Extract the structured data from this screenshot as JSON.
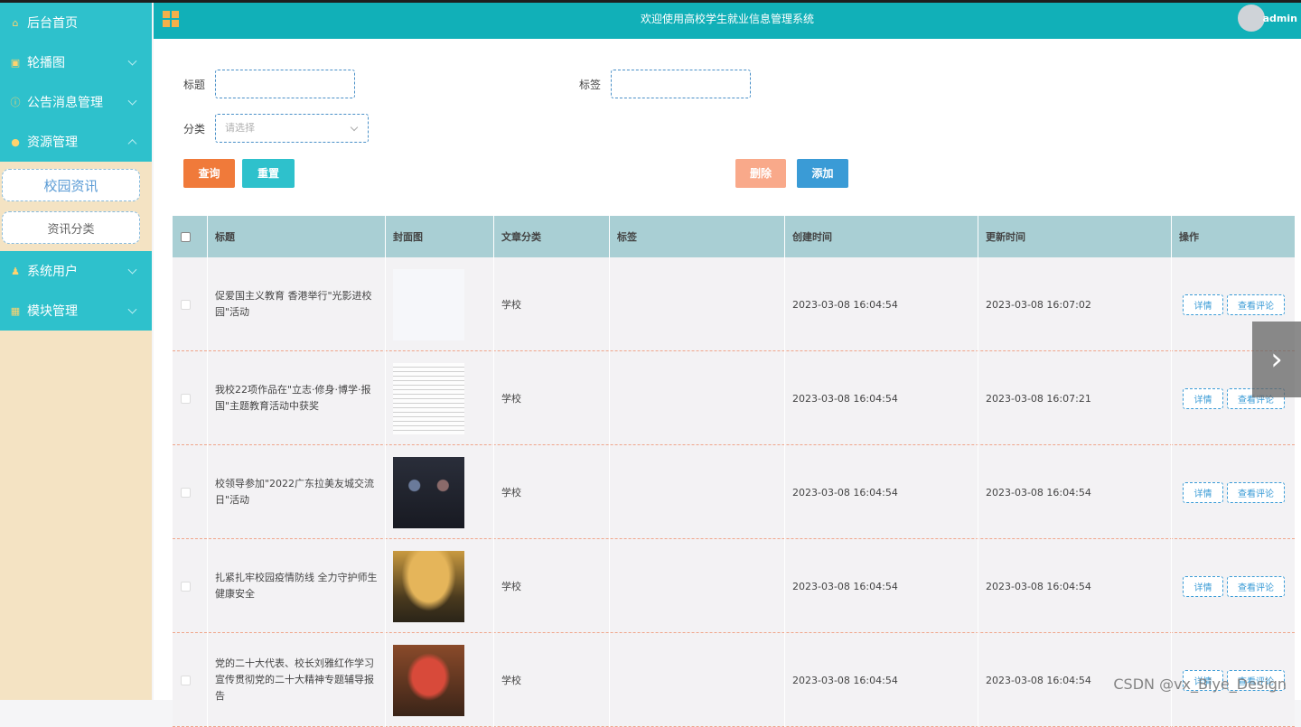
{
  "sidebar": {
    "items": [
      {
        "label": "后台首页",
        "icon": "home-icon"
      },
      {
        "label": "轮播图",
        "icon": "image-icon"
      },
      {
        "label": "公告消息管理",
        "icon": "info-icon"
      },
      {
        "label": "资源管理",
        "icon": "pin-icon"
      },
      {
        "label": "系统用户",
        "icon": "user-icon"
      },
      {
        "label": "模块管理",
        "icon": "grid-icon"
      }
    ],
    "subitems": [
      {
        "label": "校园资讯"
      },
      {
        "label": "资讯分类"
      }
    ]
  },
  "header": {
    "title": "欢迎使用高校学生就业信息管理系统",
    "user": "admin"
  },
  "filters": {
    "title_label": "标题",
    "tag_label": "标签",
    "category_label": "分类",
    "category_placeholder": "请选择"
  },
  "buttons": {
    "query": "查询",
    "reset": "重置",
    "delete": "删除",
    "add": "添加"
  },
  "colors": {
    "header": "#11b0b8",
    "sidebar": "#2ec1cc",
    "query": "#f07a3a",
    "reset": "#2ec1cc",
    "delete": "#f9a98a",
    "add": "#3a9bd6",
    "table_head": "#a9cfd4"
  },
  "table": {
    "headers": [
      "标题",
      "封面图",
      "文章分类",
      "标签",
      "创建时间",
      "更新时间",
      "操作"
    ],
    "rows": [
      {
        "title": "促爱国主义教育 香港举行\"光影进校园\"活动",
        "category": "学校",
        "tag": "",
        "created": "2023-03-08 16:04:54",
        "updated": "2023-03-08 16:07:02"
      },
      {
        "title": "我校22项作品在\"立志·修身·博学·报国\"主题教育活动中获奖",
        "category": "学校",
        "tag": "",
        "created": "2023-03-08 16:04:54",
        "updated": "2023-03-08 16:07:21"
      },
      {
        "title": "校领导参加\"2022广东拉美友城交流日\"活动",
        "category": "学校",
        "tag": "",
        "created": "2023-03-08 16:04:54",
        "updated": "2023-03-08 16:04:54"
      },
      {
        "title": "扎紧扎牢校园疫情防线 全力守护师生健康安全",
        "category": "学校",
        "tag": "",
        "created": "2023-03-08 16:04:54",
        "updated": "2023-03-08 16:04:54"
      },
      {
        "title": "党的二十大代表、校长刘雅红作学习宣传贯彻党的二十大精神专题辅导报告",
        "category": "学校",
        "tag": "",
        "created": "2023-03-08 16:04:54",
        "updated": "2023-03-08 16:04:54"
      }
    ],
    "op_detail": "详情",
    "op_comments": "查看评论"
  },
  "watermark": "CSDN @vx_Biye_Design"
}
